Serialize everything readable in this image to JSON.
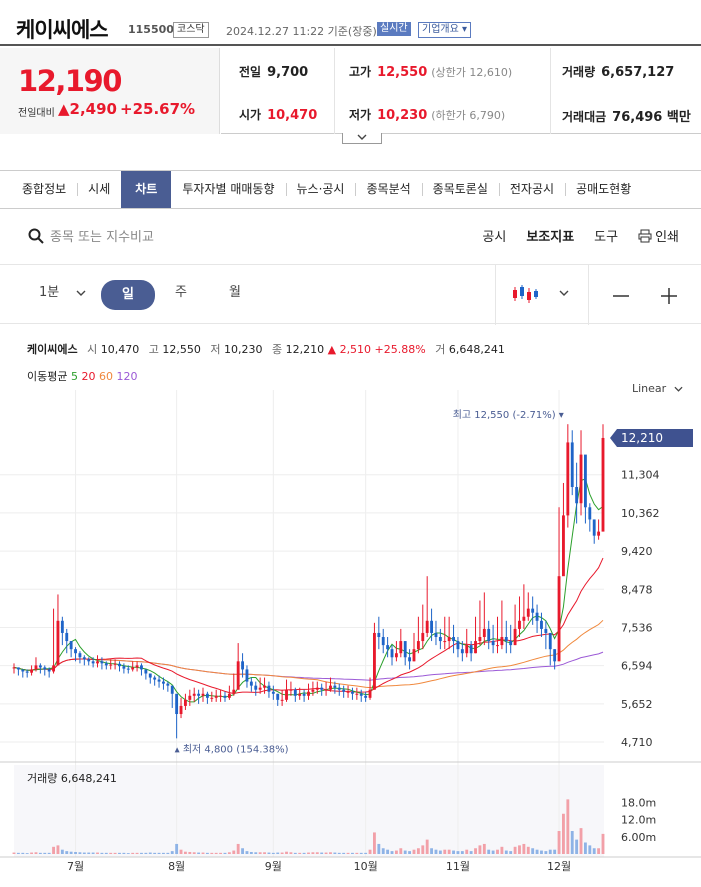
{
  "header": {
    "name": "케이씨에스",
    "code": "115500",
    "market": "코스닥",
    "datetime": "2024.12.27 11:22 기준(장중)",
    "realtime": "실시간",
    "company_info": "기업개요 ▾"
  },
  "price": {
    "current": "12,190",
    "change_label": "전일대비",
    "change_amount": "▲2,490",
    "change_pct": "+25.67%"
  },
  "stats": {
    "prev_label": "전일",
    "prev": "9,700",
    "open_label": "시가",
    "open": "10,470",
    "high_label": "고가",
    "high": "12,550",
    "upper_limit": "(상한가 12,610)",
    "low_label": "저가",
    "low": "10,230",
    "lower_limit": "(하한가 6,790)",
    "volume_label": "거래량",
    "volume": "6,657,127",
    "amount_label": "거래대금",
    "amount": "76,496 백만"
  },
  "tabs": [
    "종합정보",
    "시세",
    "차트",
    "투자자별 매매동향",
    "뉴스·공시",
    "종목분석",
    "종목토론실",
    "전자공시",
    "공매도현황"
  ],
  "toolbar": {
    "search_placeholder": "종목 또는 지수비교",
    "disclosure": "공시",
    "indicators": "보조지표",
    "tools": "도구",
    "print": "인쇄",
    "interval_minute": "1분",
    "interval_day": "일",
    "interval_week": "주",
    "interval_month": "월"
  },
  "chart_legend": {
    "name": "케이씨에스",
    "o_label": "시",
    "o": "10,470",
    "h_label": "고",
    "h": "12,550",
    "l_label": "저",
    "l": "10,230",
    "c_label": "종",
    "c": "12,210",
    "chg": "▲ 2,510 +25.88%",
    "v_label": "거",
    "v": "6,648,241",
    "ma_label": "이동평균",
    "ma5": "5",
    "ma20": "20",
    "ma60": "60",
    "ma120": "120",
    "scale": "Linear",
    "volume_text": "거래량 6,648,241"
  },
  "colors": {
    "up": "#e8192c",
    "down": "#1e64c8",
    "accent": "#4a5d93",
    "ma5": "#2ca02c",
    "ma20": "#e8192c",
    "ma60": "#f0883c",
    "ma120": "#9b59d6"
  },
  "chart_data": {
    "type": "candlestick",
    "y_axis_ticks": [
      "11,304",
      "10,362",
      "9,420",
      "8,478",
      "7,536",
      "6,594",
      "5,652",
      "4,710"
    ],
    "ylim": [
      4710,
      12900
    ],
    "current_price_label": "12,210",
    "current_price": 12210,
    "max_label": "최고 12,550 (-2.71%)",
    "max_value": 12550,
    "min_label": "최저 4,800 (154.38%)",
    "min_value": 4800,
    "x_tick_labels": [
      "7월",
      "8월",
      "9월",
      "10월",
      "11월",
      "12월"
    ],
    "x_tick_index": [
      14,
      37,
      59,
      80,
      101,
      124
    ],
    "volume_ticks": [
      "18.0m",
      "12.0m",
      "6.00m"
    ],
    "volume_ylim": [
      0,
      24000000
    ],
    "closes": [
      6550,
      6500,
      6450,
      6420,
      6500,
      6600,
      6550,
      6500,
      6450,
      6600,
      7700,
      7400,
      7200,
      7000,
      6900,
      6800,
      6750,
      6700,
      6650,
      6700,
      6650,
      6600,
      6620,
      6640,
      6580,
      6520,
      6500,
      6550,
      6600,
      6500,
      6400,
      6300,
      6250,
      6200,
      6150,
      6100,
      5900,
      5400,
      5600,
      5750,
      5850,
      5900,
      5850,
      5900,
      5800,
      5800,
      5850,
      5850,
      5800,
      5900,
      6000,
      6700,
      6500,
      6200,
      6100,
      6000,
      6050,
      6100,
      5950,
      5900,
      5750,
      5750,
      6000,
      6000,
      5850,
      5900,
      5850,
      5950,
      6000,
      6050,
      6000,
      6000,
      6100,
      6050,
      6000,
      5950,
      5950,
      5900,
      5900,
      5850,
      5800,
      6000,
      7400,
      7300,
      7100,
      7000,
      6800,
      6900,
      7200,
      6800,
      6700,
      7000,
      7200,
      7400,
      7700,
      7400,
      7300,
      7200,
      7200,
      7300,
      7200,
      7000,
      6900,
      7100,
      6900,
      7200,
      7300,
      7500,
      7200,
      7100,
      7100,
      7300,
      7200,
      7100,
      7500,
      7700,
      7800,
      8000,
      7900,
      7700,
      7500,
      7400,
      7000,
      6700,
      8800,
      10300,
      12100,
      11000,
      10600,
      11800,
      10500,
      10200,
      9800,
      9900,
      12210
    ],
    "highs": [
      6650,
      6550,
      6500,
      6500,
      6600,
      6800,
      6650,
      6600,
      6550,
      8000,
      8350,
      7800,
      7500,
      7200,
      7050,
      6950,
      6850,
      6800,
      6800,
      6850,
      6800,
      6700,
      6750,
      6750,
      6700,
      6650,
      6600,
      6700,
      6700,
      6650,
      6500,
      6400,
      6350,
      6350,
      6300,
      6200,
      6100,
      5700,
      5800,
      5900,
      6000,
      6050,
      6000,
      6050,
      5950,
      5950,
      6000,
      6000,
      5950,
      6100,
      6400,
      7150,
      6900,
      6600,
      6300,
      6200,
      6300,
      6300,
      6200,
      6100,
      5900,
      6000,
      6250,
      6200,
      6050,
      6050,
      6000,
      6150,
      6200,
      6200,
      6150,
      6200,
      6300,
      6200,
      6150,
      6100,
      6100,
      6050,
      6050,
      6000,
      5950,
      6300,
      7650,
      7800,
      7500,
      7300,
      7100,
      7200,
      7500,
      7100,
      7000,
      7400,
      7800,
      8100,
      8800,
      8000,
      7700,
      7500,
      7800,
      7800,
      7600,
      7300,
      7200,
      7500,
      7200,
      7800,
      8200,
      8400,
      7700,
      7600,
      7800,
      8200,
      7700,
      7600,
      8100,
      8300,
      8600,
      8400,
      8300,
      8100,
      7900,
      7700,
      7400,
      7000,
      10500,
      11100,
      12550,
      12400,
      11600,
      12400,
      11500,
      10600,
      10200,
      10200,
      12550
    ],
    "lows": [
      6400,
      6350,
      6300,
      6300,
      6350,
      6450,
      6400,
      6350,
      6300,
      6400,
      6900,
      7100,
      6900,
      6800,
      6700,
      6650,
      6600,
      6600,
      6550,
      6550,
      6500,
      6500,
      6500,
      6500,
      6450,
      6400,
      6400,
      6450,
      6450,
      6350,
      6250,
      6150,
      6100,
      6050,
      6000,
      5950,
      5550,
      4800,
      5300,
      5500,
      5600,
      5700,
      5650,
      5700,
      5650,
      5700,
      5700,
      5700,
      5700,
      5750,
      5850,
      6000,
      6300,
      6050,
      5950,
      5850,
      5900,
      5900,
      5800,
      5750,
      5600,
      5600,
      5700,
      5850,
      5700,
      5750,
      5700,
      5750,
      5850,
      5900,
      5850,
      5850,
      5950,
      5900,
      5850,
      5800,
      5800,
      5750,
      5750,
      5700,
      5700,
      5750,
      6000,
      7000,
      6900,
      6800,
      6600,
      6700,
      6800,
      6600,
      6500,
      6700,
      6900,
      7000,
      7300,
      7200,
      7100,
      7000,
      7000,
      7000,
      6900,
      6800,
      6700,
      6800,
      6700,
      6900,
      7100,
      7100,
      7000,
      6900,
      6900,
      7000,
      6900,
      6900,
      7100,
      7300,
      7500,
      7700,
      7600,
      7400,
      7300,
      7000,
      6600,
      6500,
      6800,
      8900,
      10000,
      10800,
      10100,
      10300,
      10100,
      9900,
      9600,
      9700,
      10230
    ],
    "volumes_m": [
      0.5,
      0.4,
      0.4,
      0.3,
      0.5,
      0.6,
      0.4,
      0.4,
      0.4,
      2.5,
      3.0,
      1.5,
      1.0,
      0.8,
      0.7,
      0.6,
      0.5,
      0.5,
      0.5,
      0.5,
      0.4,
      0.4,
      0.4,
      0.4,
      0.4,
      0.4,
      0.3,
      0.4,
      0.4,
      0.4,
      0.4,
      0.5,
      0.4,
      0.4,
      0.4,
      0.4,
      1.0,
      3.5,
      1.5,
      0.8,
      0.7,
      0.6,
      0.5,
      0.5,
      0.4,
      0.4,
      0.4,
      0.4,
      0.4,
      0.6,
      1.2,
      3.5,
      2.0,
      1.0,
      0.7,
      0.6,
      0.6,
      0.6,
      0.5,
      0.4,
      0.5,
      0.5,
      0.8,
      0.6,
      0.4,
      0.4,
      0.4,
      0.5,
      0.6,
      0.6,
      0.5,
      0.5,
      0.6,
      0.5,
      0.4,
      0.4,
      0.4,
      0.4,
      0.4,
      0.4,
      0.4,
      1.5,
      7.5,
      3.5,
      2.0,
      1.5,
      1.0,
      1.2,
      2.0,
      1.2,
      1.0,
      1.5,
      2.0,
      3.0,
      5.0,
      2.0,
      1.5,
      1.2,
      1.5,
      1.5,
      1.2,
      1.0,
      1.0,
      1.5,
      1.0,
      2.0,
      3.0,
      3.5,
      1.5,
      1.2,
      1.5,
      2.5,
      1.2,
      1.0,
      2.5,
      3.0,
      3.5,
      2.5,
      2.0,
      1.5,
      1.2,
      1.0,
      1.5,
      1.5,
      8.0,
      14.0,
      19.0,
      8.0,
      5.0,
      9.0,
      4.0,
      3.0,
      2.0,
      2.0,
      7.0
    ]
  }
}
